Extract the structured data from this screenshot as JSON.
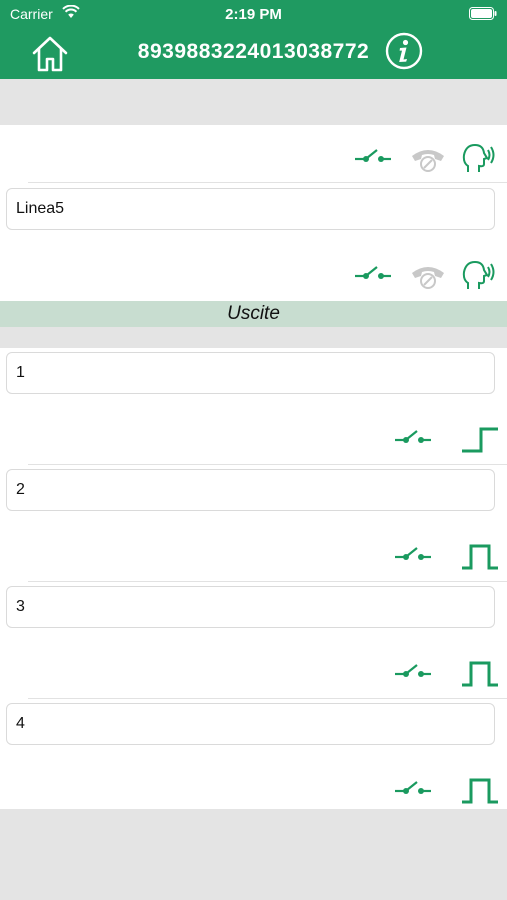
{
  "status_bar": {
    "carrier": "Carrier",
    "time": "2:19 PM"
  },
  "navbar": {
    "title": "89398832240130387​72",
    "home_icon": "home-icon",
    "info_icon": "info-icon"
  },
  "line_section": {
    "field_value": "Linea5",
    "row_icons": [
      "relay-switch-icon",
      "phone-hangup-icon",
      "speaking-head-icon"
    ]
  },
  "outputs_section": {
    "header": "Uscite",
    "items": [
      {
        "value": "1",
        "mode_icon": "step-signal-icon"
      },
      {
        "value": "2",
        "mode_icon": "pulse-signal-icon"
      },
      {
        "value": "3",
        "mode_icon": "pulse-signal-icon"
      },
      {
        "value": "4",
        "mode_icon": "pulse-signal-icon"
      }
    ]
  },
  "colors": {
    "brand_green": "#1f9a61",
    "icon_green": "#1a9a5f",
    "disabled_gray": "#c8c8c8",
    "section_band": "#c8ddd0"
  }
}
